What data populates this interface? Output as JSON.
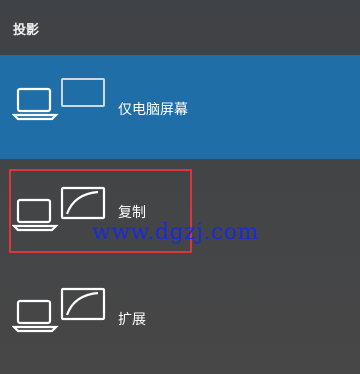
{
  "panel": {
    "title": "投影"
  },
  "options": [
    {
      "label": "仅电脑屏幕",
      "icon": "pc-screen-only-icon",
      "selected": true
    },
    {
      "label": "复制",
      "icon": "duplicate-icon",
      "selected": false
    },
    {
      "label": "扩展",
      "icon": "extend-icon",
      "selected": false
    }
  ],
  "watermark": {
    "text": "www.dgzj.com"
  },
  "colors": {
    "selected": "#1f6ea8",
    "background": "#474747",
    "highlight": "#d9383a",
    "watermark": "#1a2ad8"
  }
}
